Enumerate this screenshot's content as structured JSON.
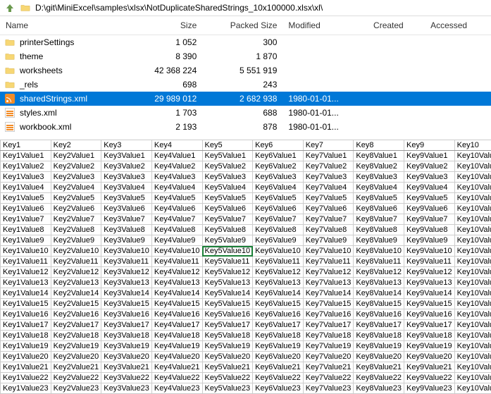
{
  "pathbar": {
    "path": "D:\\git\\MiniExcel\\samples\\xlsx\\NotDuplicateSharedStrings_10x100000.xlsx\\xl\\"
  },
  "columns": {
    "name": "Name",
    "size": "Size",
    "packed": "Packed Size",
    "modified": "Modified",
    "created": "Created",
    "accessed": "Accessed"
  },
  "rows": [
    {
      "icon": "folder",
      "name": "printerSettings",
      "size": "1 052",
      "packed": "300",
      "modified": "",
      "selected": false
    },
    {
      "icon": "folder",
      "name": "theme",
      "size": "8 390",
      "packed": "1 870",
      "modified": "",
      "selected": false
    },
    {
      "icon": "folder",
      "name": "worksheets",
      "size": "42 368 224",
      "packed": "5 551 919",
      "modified": "",
      "selected": false
    },
    {
      "icon": "folder",
      "name": "_rels",
      "size": "698",
      "packed": "243",
      "modified": "",
      "selected": false
    },
    {
      "icon": "rss",
      "name": "sharedStrings.xml",
      "size": "29 989 012",
      "packed": "2 682 938",
      "modified": "1980-01-01...",
      "selected": true
    },
    {
      "icon": "xml",
      "name": "styles.xml",
      "size": "1 703",
      "packed": "688",
      "modified": "1980-01-01...",
      "selected": false
    },
    {
      "icon": "xml",
      "name": "workbook.xml",
      "size": "2 193",
      "packed": "878",
      "modified": "1980-01-01...",
      "selected": false
    }
  ],
  "sheet": {
    "headers": [
      "Key1",
      "Key2",
      "Key3",
      "Key4",
      "Key5",
      "Key6",
      "Key7",
      "Key8",
      "Key9",
      "Key10"
    ],
    "rowCount": 23,
    "activeCell": {
      "row": 10,
      "col": 5
    }
  },
  "chart_data": {
    "type": "table",
    "title": "",
    "columns": [
      "Key1",
      "Key2",
      "Key3",
      "Key4",
      "Key5",
      "Key6",
      "Key7",
      "Key8",
      "Key9",
      "Key10"
    ],
    "note": "Cell values follow pattern Key{col}Value{row} for col 1..10, row 1..23"
  }
}
